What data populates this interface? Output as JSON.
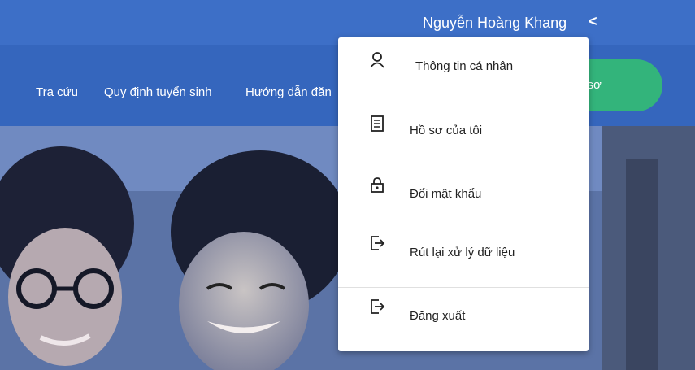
{
  "header": {
    "user_name": "Nguyễn Hoàng Khang",
    "chevron": "<"
  },
  "nav": {
    "items": [
      "Tra cứu",
      "Quy định tuyển sinh",
      "Hướng dẫn đăn"
    ],
    "cta_label": "ồ sơ"
  },
  "menu": {
    "items": [
      {
        "label": "Thông tin cá nhân",
        "icon": "user-icon"
      },
      {
        "label": "Hồ sơ của tôi",
        "icon": "document-icon"
      },
      {
        "label": "Đổi mật khẩu",
        "icon": "lock-icon"
      },
      {
        "label": "Rút lại xử lý dữ liệu",
        "icon": "exit-icon"
      },
      {
        "label": "Đăng xuất",
        "icon": "logout-icon"
      }
    ]
  },
  "colors": {
    "topbar": "#3d6fc7",
    "navbar": "#3566bd",
    "cta": "#33b47b",
    "menu_bg": "#ffffff"
  }
}
